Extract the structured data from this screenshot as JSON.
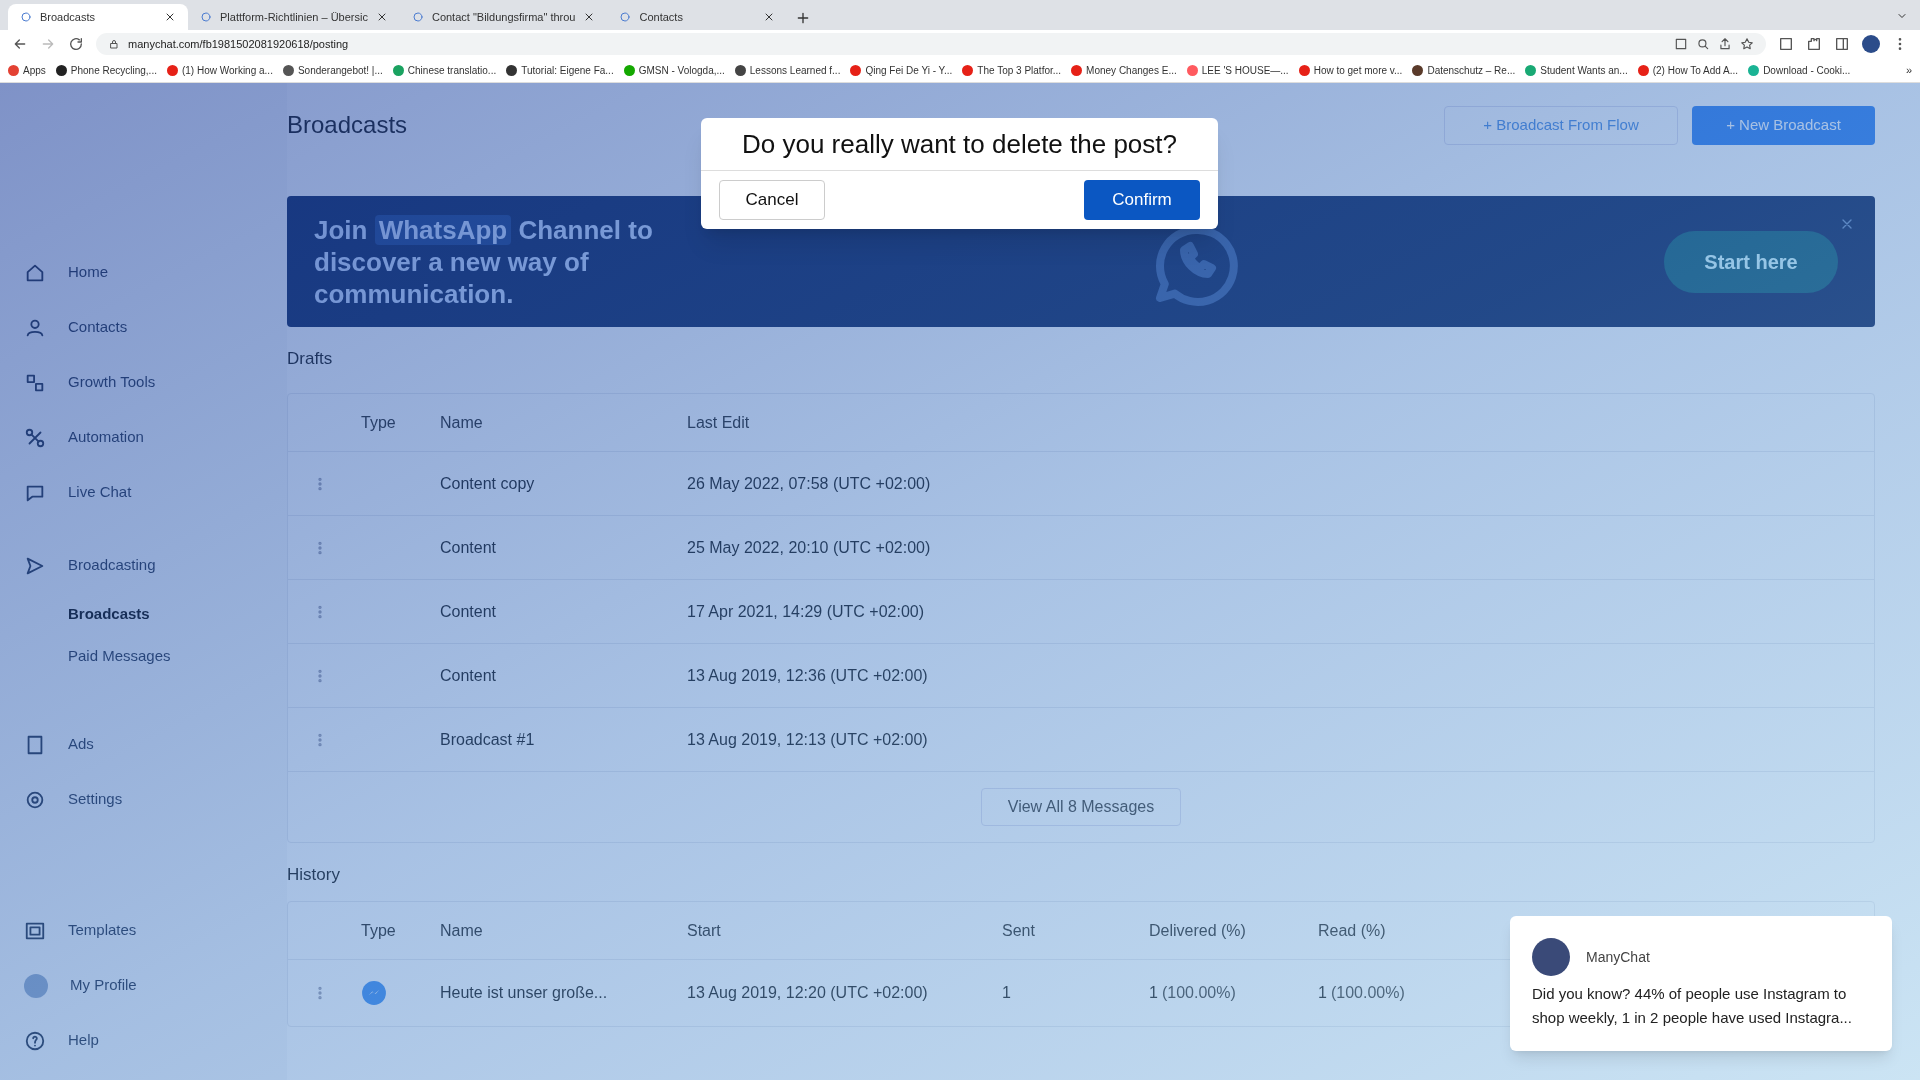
{
  "browser": {
    "tabs": [
      {
        "title": "Broadcasts",
        "selected": true
      },
      {
        "title": "Plattform-Richtlinien – Übersic",
        "selected": false
      },
      {
        "title": "Contact \"Bildungsfirma\" throu",
        "selected": false
      },
      {
        "title": "Contacts",
        "selected": false
      }
    ],
    "url": "manychat.com/fb1981502081920618/posting",
    "bookmarks": [
      {
        "label": "Apps",
        "color": "#e34133"
      },
      {
        "label": "Phone Recycling,...",
        "color": "#222222"
      },
      {
        "label": "(1) How Working a...",
        "color": "#e62117"
      },
      {
        "label": "Sonderangebot! |...",
        "color": "#555555"
      },
      {
        "label": "Chinese translatio...",
        "color": "#1aa260"
      },
      {
        "label": "Tutorial: Eigene Fa...",
        "color": "#333333"
      },
      {
        "label": "GMSN - Vologda,...",
        "color": "#14a800"
      },
      {
        "label": "Lessons Learned f...",
        "color": "#444444"
      },
      {
        "label": "Qing Fei De Yi - Y...",
        "color": "#e62117"
      },
      {
        "label": "The Top 3 Platfor...",
        "color": "#e62117"
      },
      {
        "label": "Money Changes E...",
        "color": "#e62117"
      },
      {
        "label": "LEE 'S HOUSE—...",
        "color": "#ff5a5f"
      },
      {
        "label": "How to get more v...",
        "color": "#e62117"
      },
      {
        "label": "Datenschutz – Re...",
        "color": "#5a3a2a"
      },
      {
        "label": "Student Wants an...",
        "color": "#19a974"
      },
      {
        "label": "(2) How To Add A...",
        "color": "#e62117"
      },
      {
        "label": "Download - Cooki...",
        "color": "#1ab394"
      }
    ],
    "more": "»"
  },
  "sidebar": {
    "items": [
      {
        "label": "Home",
        "selected": false
      },
      {
        "label": "Contacts",
        "selected": false
      },
      {
        "label": "Growth Tools",
        "selected": false
      },
      {
        "label": "Automation",
        "selected": false
      },
      {
        "label": "Live Chat",
        "selected": false
      },
      {
        "label": "Broadcasting",
        "selected": false,
        "children": [
          {
            "label": "Broadcasts",
            "selected": true
          },
          {
            "label": "Paid Messages",
            "selected": false
          }
        ]
      },
      {
        "label": "Ads",
        "selected": false
      },
      {
        "label": "Settings",
        "selected": false
      }
    ],
    "bottom_items": [
      {
        "label": "Templates"
      },
      {
        "label": "My Profile"
      },
      {
        "label": "Help"
      }
    ]
  },
  "page": {
    "title": "Broadcasts",
    "buttons": [
      "+ Broadcast From Flow",
      "+ New Broadcast"
    ]
  },
  "banner": {
    "text_before": "Join",
    "highlight": "WhatsApp",
    "text_after": "Channel to discover a new way of communication.",
    "button": "Start here"
  },
  "drafts": {
    "title": "Drafts",
    "columns": [
      "Type",
      "Name",
      "Last Edit"
    ],
    "rows": [
      {
        "name": "Content copy",
        "last_edit": "26 May 2022, 07:58 (UTC +02:00)"
      },
      {
        "name": "Content",
        "last_edit": "25 May 2022, 20:10 (UTC +02:00)"
      },
      {
        "name": "Content",
        "last_edit": "17 Apr 2021, 14:29 (UTC +02:00)"
      },
      {
        "name": "Content",
        "last_edit": "13 Aug 2019, 12:36 (UTC +02:00)"
      },
      {
        "name": "Broadcast #1",
        "last_edit": "13 Aug 2019, 12:13 (UTC +02:00)"
      }
    ],
    "view_all": "View All 8 Messages"
  },
  "history": {
    "title": "History",
    "columns": [
      "Type",
      "Name",
      "Start",
      "Sent",
      "Delivered (%)",
      "Read (%)"
    ],
    "rows": [
      {
        "name": "Heute ist unser große...",
        "start": "13 Aug 2019, 12:20 (UTC +02:00)",
        "sent": "1",
        "delivered": "1",
        "delivered_pct": "(100.00%)",
        "read": "1",
        "read_pct": "(100.00%)"
      }
    ]
  },
  "dialog": {
    "title": "Do you really want to delete the post?",
    "cancel": "Cancel",
    "confirm": "Confirm"
  },
  "chat_popup": {
    "sender": "ManyChat",
    "message": "Did you know? 44% of people use Instagram to shop weekly, 1 in 2 people have used Instagra..."
  }
}
